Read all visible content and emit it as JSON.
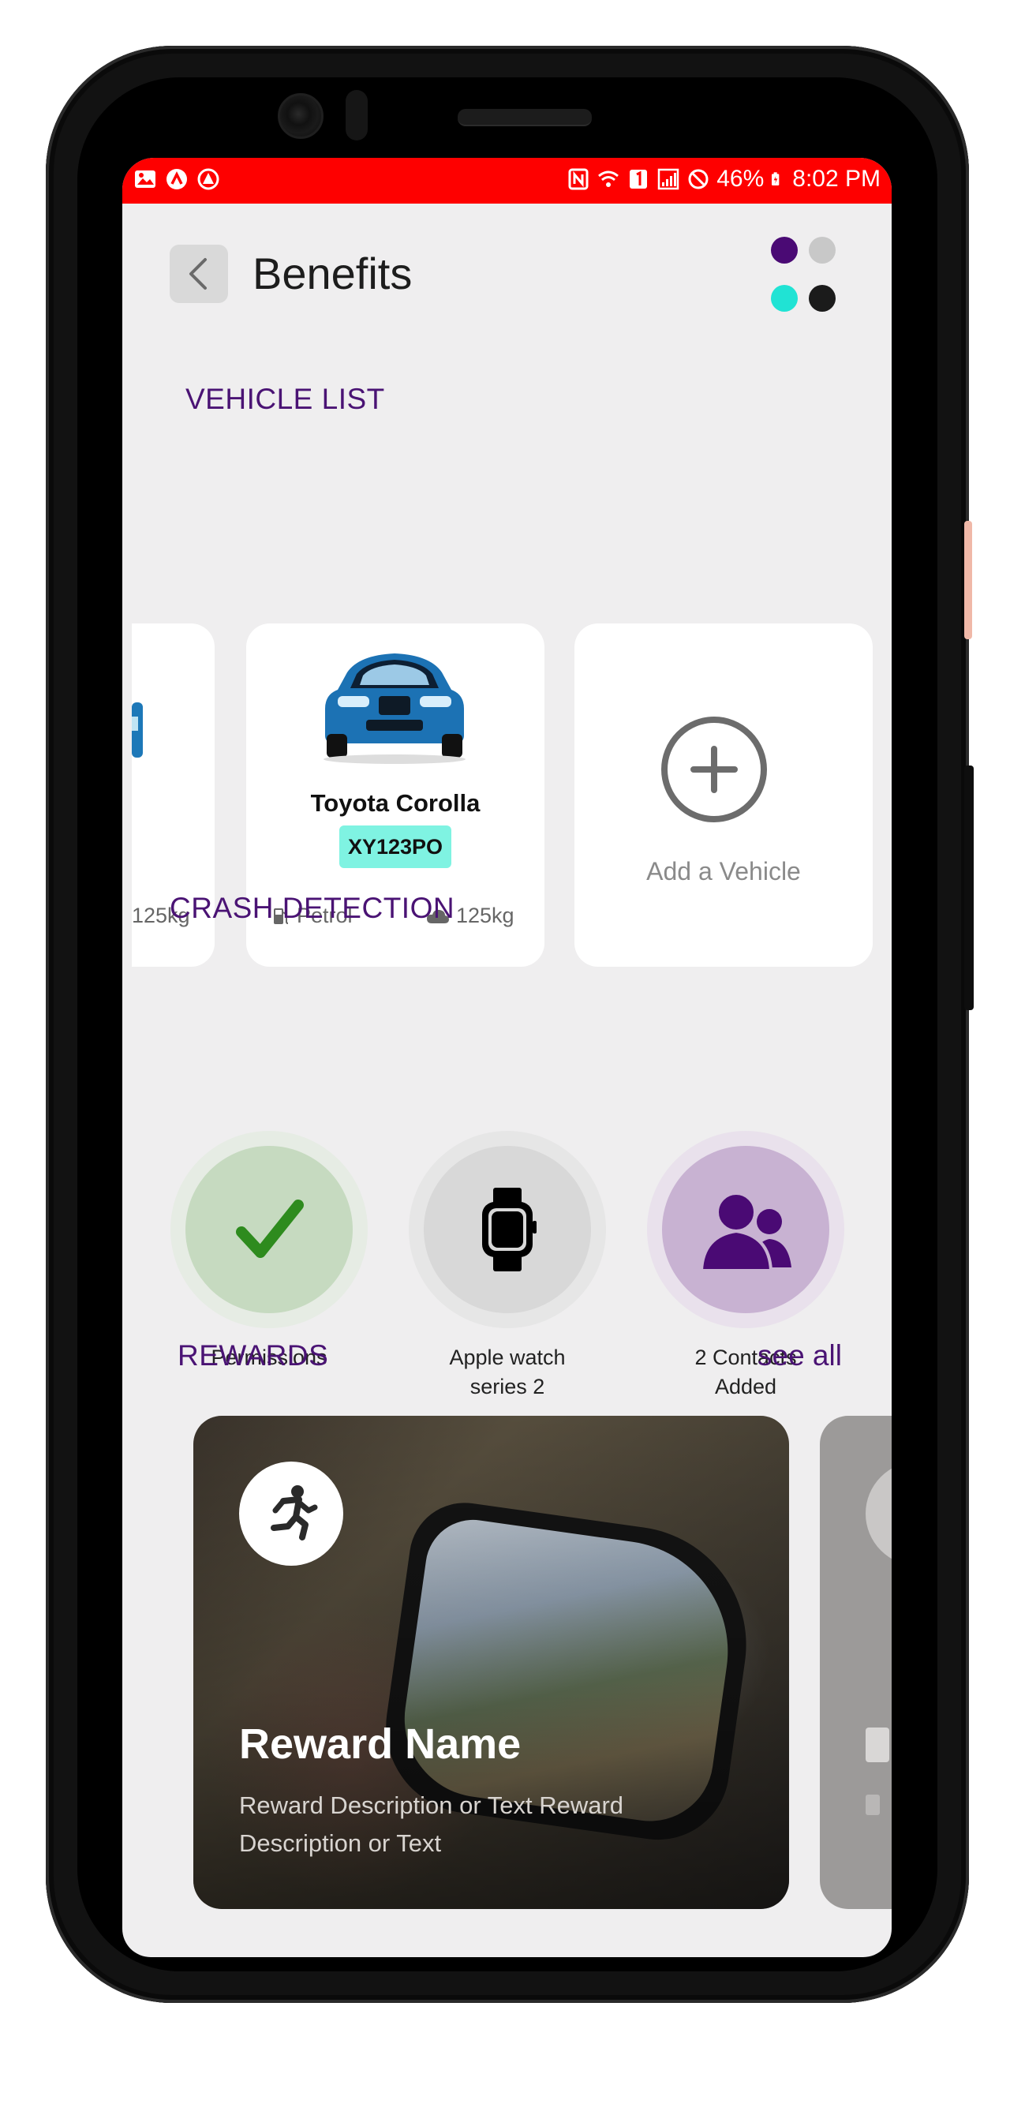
{
  "status_bar": {
    "battery": "46%",
    "time": "8:02 PM",
    "background_color": "#fe0000"
  },
  "header": {
    "title": "Benefits",
    "back_icon": "chevron-left-icon",
    "menu_icon": "dots-grid-icon",
    "dot_colors": [
      "#4a0a74",
      "#c8c8c8",
      "#20e3d4",
      "#1b1b1b"
    ]
  },
  "vehicle_list": {
    "section_title": "VEHICLE LIST",
    "partial_card": {
      "weight": "125kg"
    },
    "vehicles": [
      {
        "name": "Toyota Corolla",
        "plate": "XY123PO",
        "fuel": "Petrol",
        "emission": "125kg"
      }
    ],
    "add_label": "Add a Vehicle"
  },
  "crash_detection": {
    "section_title": "CRASH DETECTION",
    "items": [
      {
        "label": "Permissions",
        "icon": "checkmark-icon",
        "halo_color": "#e6ece4",
        "core_color": "#c6dac0",
        "icon_color": "#2e8b1e"
      },
      {
        "label_line1": "Apple watch",
        "label_line2": "series 2",
        "icon": "smartwatch-icon",
        "halo_color": "#e6e6e6",
        "core_color": "#d8d8d8",
        "icon_color": "#000000"
      },
      {
        "label_line1": "2 Contacts",
        "label_line2": "Added",
        "icon": "contacts-icon",
        "halo_color": "#e9e1ec",
        "core_color": "#c8b2d2",
        "icon_color": "#4a0a74"
      }
    ]
  },
  "rewards": {
    "section_title": "REWARDS",
    "see_all": "see all",
    "cards": [
      {
        "name": "Reward Name",
        "description": "Reward Description or Text Reward Description or Text",
        "icon": "running-person-icon"
      }
    ]
  }
}
